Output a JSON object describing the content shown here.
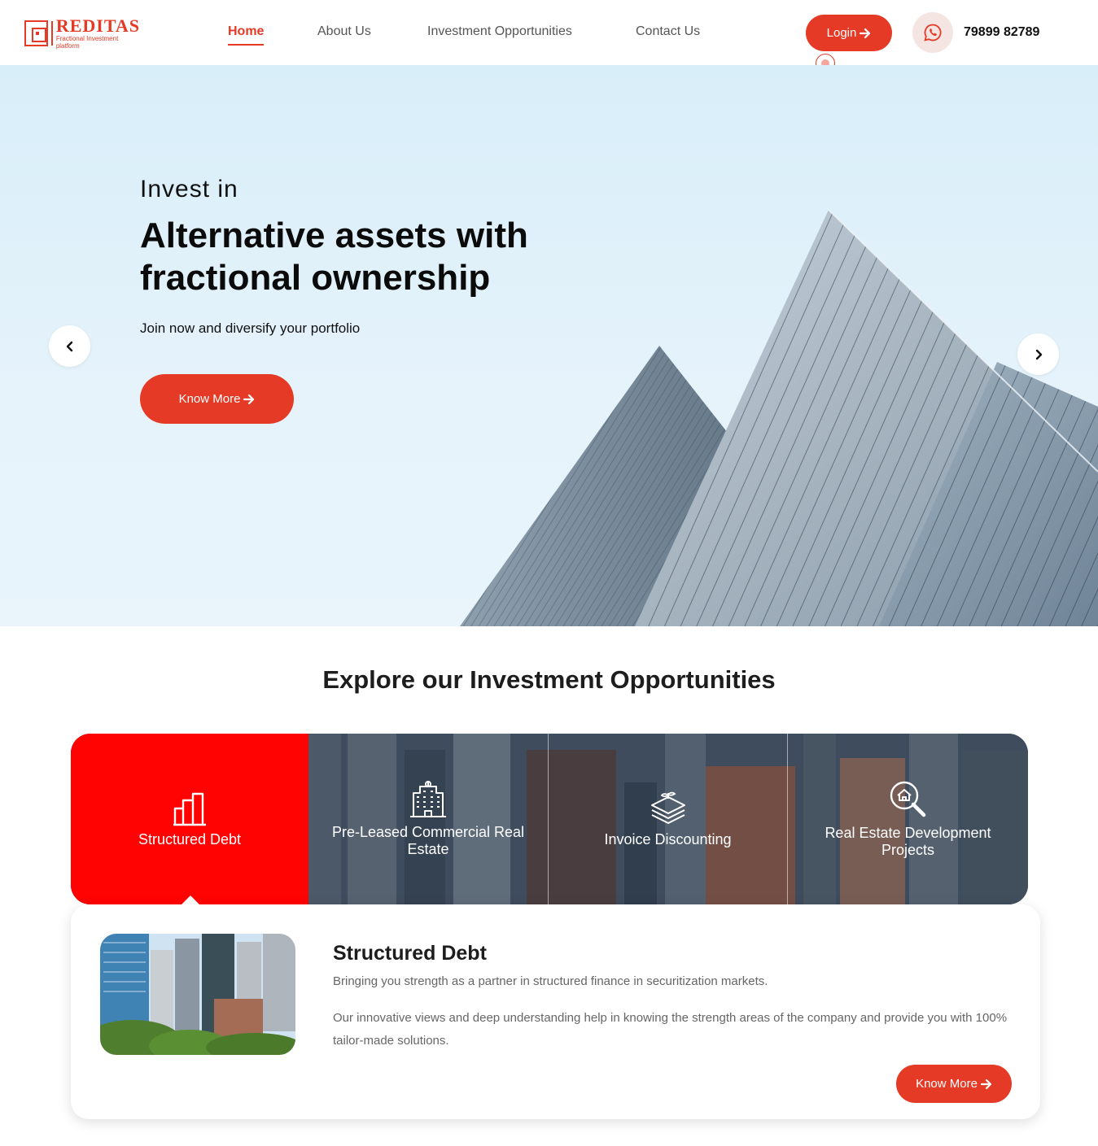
{
  "header": {
    "logo": {
      "name": "REDITAS",
      "tagline": "Fractional Investment platform"
    },
    "nav": [
      {
        "label": "Home",
        "active": true
      },
      {
        "label": "About Us",
        "active": false
      },
      {
        "label": "Investment Opportunities",
        "active": false
      },
      {
        "label": "Contact Us",
        "active": false
      }
    ],
    "login_label": "Login",
    "login_icon": "arrow-right-icon",
    "whatsapp_icon": "whatsapp-icon",
    "phone": "79899 82789"
  },
  "hero": {
    "eyebrow": "Invest in",
    "title": "Alternative assets with fractional ownership",
    "subtitle": "Join now and diversify your portfolio",
    "cta_label": "Know More",
    "cta_icon": "arrow-right-icon",
    "prev_icon": "chevron-left-icon",
    "next_icon": "chevron-right-icon"
  },
  "explore": {
    "title": "Explore our Investment Opportunities",
    "tabs": [
      {
        "label": "Structured Debt",
        "icon": "building-chart-icon",
        "active": true
      },
      {
        "label": "Pre-Leased Commercial Real Estate",
        "icon": "office-building-icon",
        "active": false
      },
      {
        "label": "Invoice Discounting",
        "icon": "invoice-stack-icon",
        "active": false
      },
      {
        "label": "Real Estate Development Projects",
        "icon": "house-search-icon",
        "active": false
      }
    ],
    "detail": {
      "title": "Structured Debt",
      "paragraph1": "Bringing you strength as a partner in structured finance in securitization markets.",
      "paragraph2": "Our innovative views and deep understanding help in knowing the strength areas of the company and provide you with 100% tailor-made solutions.",
      "cta_label": "Know More"
    }
  },
  "colors": {
    "brand": "#e53a26",
    "active_tab": "#ff0202",
    "hero_sky": "#d8eef9"
  }
}
